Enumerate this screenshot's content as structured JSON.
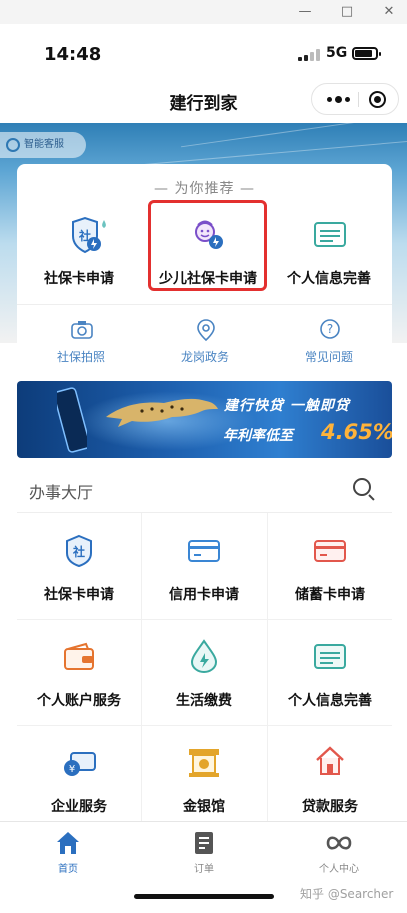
{
  "window": {
    "min_label": "—",
    "max_label": "□",
    "close_label": "✕"
  },
  "status_bar": {
    "time": "14:48",
    "network": "5G"
  },
  "nav": {
    "title": "建行到家"
  },
  "hero": {
    "kefu_label": "智能客服"
  },
  "recommend": {
    "title": "— 为你推荐 —",
    "items": [
      {
        "label": "社保卡申请",
        "icon": "shebao-card-icon"
      },
      {
        "label": "少儿社保卡申请",
        "icon": "child-shebao-icon"
      },
      {
        "label": "个人信息完善",
        "icon": "id-card-icon"
      }
    ],
    "sub_items": [
      {
        "label": "社保拍照",
        "icon": "camera-icon"
      },
      {
        "label": "龙岗政务",
        "icon": "location-icon"
      },
      {
        "label": "常见问题",
        "icon": "question-icon"
      }
    ]
  },
  "banner": {
    "line1": "建行快贷 一触即贷",
    "line2": "年利率低至",
    "rate": "4.65%"
  },
  "hall": {
    "title": "办事大厅",
    "items": [
      {
        "label": "社保卡申请",
        "icon": "shebao-icon"
      },
      {
        "label": "信用卡申请",
        "icon": "credit-card-icon"
      },
      {
        "label": "储蓄卡申请",
        "icon": "debit-card-icon"
      },
      {
        "label": "个人账户服务",
        "icon": "wallet-icon"
      },
      {
        "label": "生活缴费",
        "icon": "water-drop-icon"
      },
      {
        "label": "个人信息完善",
        "icon": "id-card-icon"
      },
      {
        "label": "企业服务",
        "icon": "enterprise-icon"
      },
      {
        "label": "金银馆",
        "icon": "gold-icon"
      },
      {
        "label": "贷款服务",
        "icon": "house-icon"
      }
    ]
  },
  "tabbar": {
    "tabs": [
      {
        "label": "首页",
        "icon": "home-icon",
        "active": true
      },
      {
        "label": "订单",
        "icon": "order-icon",
        "active": false
      },
      {
        "label": "个人中心",
        "icon": "user-center-icon",
        "active": false
      }
    ],
    "watermark": "知乎 @Searcher"
  },
  "colors": {
    "brand_blue": "#2b6fbf",
    "highlight_red": "#e3302f",
    "link_blue": "#4a84c2",
    "accent_orange": "#ffb33a"
  }
}
